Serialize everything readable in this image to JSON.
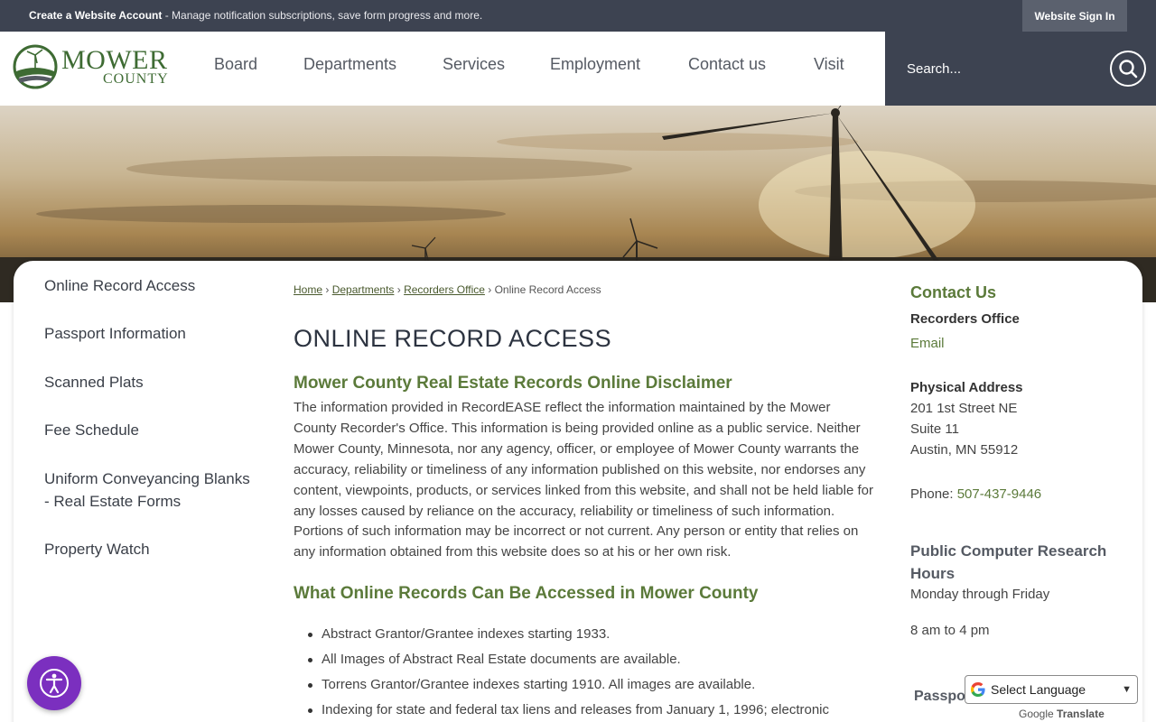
{
  "topbar": {
    "create_account": "Create a Website Account",
    "message": " - Manage notification subscriptions, save form progress and more.",
    "signin_label": "Website Sign In"
  },
  "logo": {
    "line1": "MOWER",
    "line2": "COUNTY"
  },
  "nav": [
    "Board",
    "Departments",
    "Services",
    "Employment",
    "Contact us",
    "Visit"
  ],
  "search": {
    "placeholder": "Search..."
  },
  "sidebar": {
    "items": [
      {
        "label": "Online Record Access"
      },
      {
        "label": "Passport Information"
      },
      {
        "label": "Scanned Plats"
      },
      {
        "label": "Fee Schedule"
      },
      {
        "label": "Uniform Conveyancing Blanks - Real Estate Forms"
      },
      {
        "label": "Property Watch"
      }
    ]
  },
  "breadcrumb": {
    "home": "Home",
    "departments": "Departments",
    "recorders": "Recorders Office",
    "current": "Online Record Access",
    "sep": "›"
  },
  "main": {
    "title": "ONLINE RECORD ACCESS",
    "disclaimer_heading": "Mower County Real Estate Records Online Disclaimer",
    "disclaimer_text": "The information provided in RecordEASE reflect the information maintained by the Mower County Recorder's Office. This information is being provided online as a public service. Neither Mower County, Minnesota, nor any agency, officer, or employee of Mower County warrants the accuracy, reliability or timeliness of any information published on this website, nor endorses any content, viewpoints, products, or services linked from this website, and shall not be held liable for any losses caused by reliance on the accuracy, reliability or timeliness of such information. Portions of such information may be incorrect or not current. Any person or entity that relies on any information obtained from this website does so at his or her own risk.",
    "records_heading": "What Online Records Can Be Accessed in Mower County",
    "bullets": [
      "Abstract Grantor/Grantee indexes starting 1933.",
      "All Images of Abstract Real Estate documents are available.",
      "Torrens Grantor/Grantee indexes starting 1910. All images are available.",
      "Indexing for state and federal tax liens and releases from January 1, 1996; electronic"
    ]
  },
  "contact": {
    "title": "Contact Us",
    "office": "Recorders Office",
    "email": "Email",
    "address_label": "Physical Address",
    "address1": "201 1st Street NE",
    "address2": "Suite 11",
    "address3": "Austin, MN 55912",
    "phone_label": "Phone: ",
    "phone": "507-437-9446",
    "hours_title": "Public Computer Research Hours",
    "hours_days": "Monday through Friday",
    "hours_time": "8 am to 4 pm",
    "passport": "Passport"
  },
  "translate": {
    "label": "Select Language",
    "powered_google": "Google",
    "powered_translate": "Translate"
  },
  "colors": {
    "accent_green": "#5b7a3a",
    "bar_dark": "#3d4351",
    "a11y_purple": "#7b2fbf"
  }
}
